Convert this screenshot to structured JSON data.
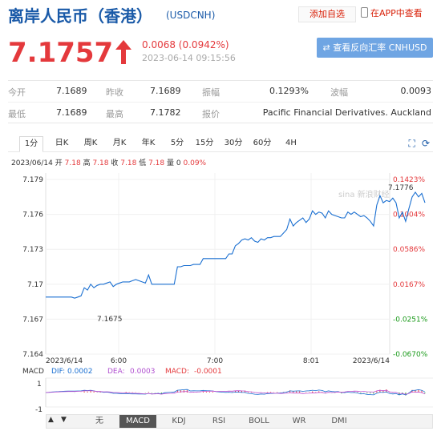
{
  "header": {
    "title": "离岸人民币（香港）",
    "code": "(USDCNH)",
    "add_watch": "添加自选",
    "app_view": "在APP中查看"
  },
  "quote": {
    "price": "7.1757",
    "change": "0.0068 (0.0942%)",
    "datetime": "2023-06-14 09:15:56",
    "reverse_button": "查看反向汇率 CNHUSD",
    "colors": {
      "up": "#e4393c",
      "down": "#1a9a1a",
      "accent": "#1a5aa8"
    }
  },
  "stats": {
    "row1": [
      {
        "label": "今开",
        "value": "7.1689"
      },
      {
        "label": "昨收",
        "value": "7.1689"
      },
      {
        "label": "振幅",
        "value": "0.1293%"
      },
      {
        "label": "波幅",
        "value": "0.0093"
      }
    ],
    "row2": [
      {
        "label": "最低",
        "value": "7.1689"
      },
      {
        "label": "最高",
        "value": "7.1782"
      },
      {
        "label": "报价",
        "value": "Pacific Financial Derivatives. Auckland"
      }
    ]
  },
  "tabs": [
    "1分",
    "日K",
    "周K",
    "月K",
    "年K",
    "5分",
    "15分",
    "30分",
    "60分",
    "4H"
  ],
  "tool_icons": [
    "expand-icon",
    "refresh-icon"
  ],
  "ohlc": {
    "date": "2023/06/14",
    "open_label": "开",
    "open": "7.18",
    "high_label": "高",
    "high": "7.18",
    "close_label": "收",
    "close": "7.18",
    "low_label": "低",
    "low": "7.18",
    "vol_label": "量",
    "vol": "0",
    "pct": "0.09%"
  },
  "chart_data": {
    "type": "line",
    "y_ticks": [
      "7.179",
      "7.176",
      "7.173",
      "7.17",
      "7.167",
      "7.164"
    ],
    "pct_ticks": [
      "0.1423%",
      "0.1004%",
      "0.0586%",
      "0.0167%",
      "-0.0251%",
      "-0.0670%"
    ],
    "x_ticks": [
      "2023/6/14",
      "6:00",
      "7:00",
      "8:01",
      "2023/6/14"
    ],
    "ylim": [
      7.164,
      7.179
    ],
    "annotations": {
      "low": "7.1675",
      "high": "7.1776"
    },
    "watermark": "sina 新浪财经",
    "series": [
      {
        "values": [
          7.1689,
          7.1689,
          7.1689,
          7.1689,
          7.1689,
          7.1689,
          7.1689,
          7.1689,
          7.1689,
          7.1688,
          7.1689,
          7.169,
          7.1697,
          7.1695,
          7.17,
          7.1697,
          7.1699,
          7.17,
          7.17,
          7.1701,
          7.1702,
          7.1698,
          7.17,
          7.1701,
          7.1702,
          7.1702,
          7.1702,
          7.1703,
          7.1704,
          7.1703,
          7.1702,
          7.1701,
          7.1708,
          7.17,
          7.17,
          7.17,
          7.17,
          7.17,
          7.17,
          7.17,
          7.17,
          7.1715,
          7.1715,
          7.1716,
          7.1716,
          7.1716,
          7.1717,
          7.1717,
          7.1717,
          7.1722,
          7.1722,
          7.1722,
          7.1722,
          7.1722,
          7.1722,
          7.1722,
          7.1722,
          7.1726,
          7.1726,
          7.1733,
          7.1735,
          7.1738,
          7.1739,
          7.1738,
          7.174,
          7.1737,
          7.1736,
          7.1739,
          7.1738,
          7.174,
          7.174,
          7.1741,
          7.1741,
          7.1741,
          7.1744,
          7.1747,
          7.1756,
          7.175,
          7.1753,
          7.1755,
          7.1757,
          7.1753,
          7.1756,
          7.1763,
          7.176,
          7.1762,
          7.1761,
          7.1757,
          7.1763,
          7.176,
          7.1759,
          7.1758,
          7.1757,
          7.1757,
          7.1762,
          7.176,
          7.1762,
          7.176,
          7.1758,
          7.1759,
          7.1757,
          7.1754,
          7.175,
          7.1768,
          7.1776,
          7.177,
          7.1772,
          7.1771,
          7.1774,
          7.177,
          7.1757,
          7.1762,
          7.1754,
          7.1765,
          7.1775,
          7.1779,
          7.1775,
          7.1778,
          7.177
        ]
      }
    ]
  },
  "macd": {
    "label": "MACD",
    "dif_label": "DIF:",
    "dif": "0.0002",
    "dea_label": "DEA:",
    "dea": "0.0003",
    "macd_label": "MACD:",
    "macd": "-0.0001",
    "y_ticks": [
      "1",
      "-1"
    ]
  },
  "indicators": [
    "无",
    "MACD",
    "KDJ",
    "RSI",
    "BOLL",
    "WR",
    "DMI"
  ],
  "active_indicator": "MACD",
  "nav": {
    "left": "▲",
    "right": "▼"
  }
}
